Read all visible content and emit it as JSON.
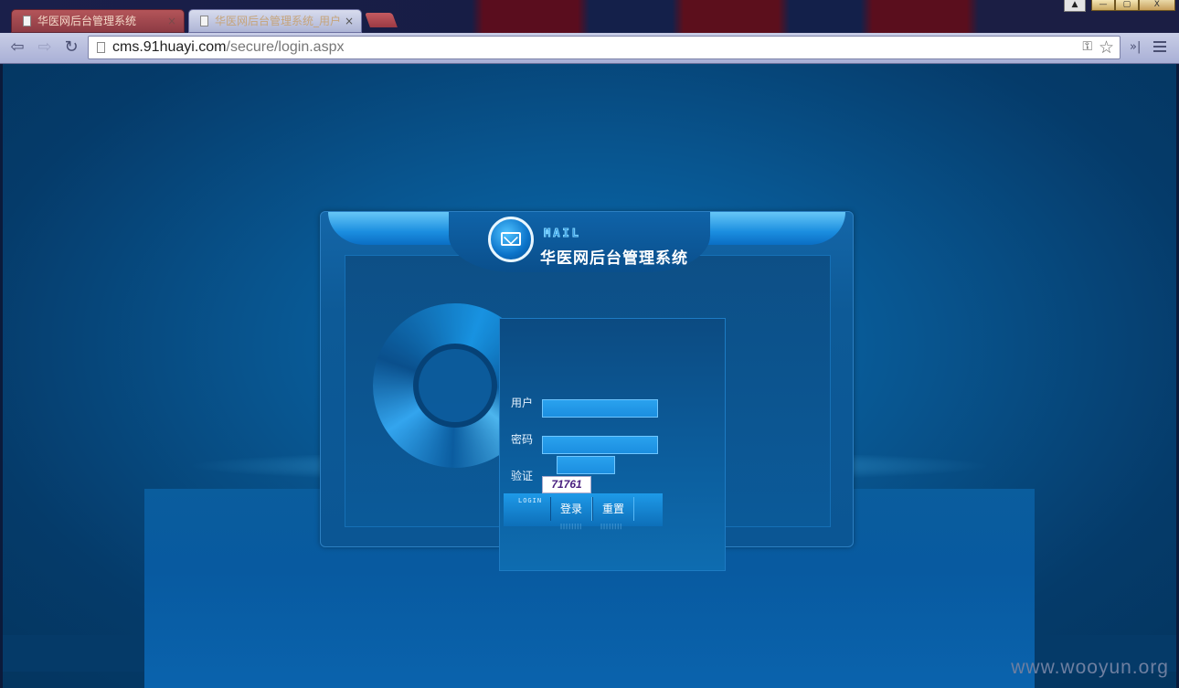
{
  "browser": {
    "tabs": [
      {
        "label": "华医网后台管理系统",
        "active": false
      },
      {
        "label": "华医网后台管理系统_用户",
        "active": true
      }
    ],
    "close_glyph": "×",
    "user_glyph": "▲",
    "window_buttons": {
      "minimize": "—",
      "maximize": "▢",
      "close": "X"
    },
    "nav": {
      "back": "⇦",
      "forward": "⇨",
      "reload": "↻"
    },
    "address": {
      "host": "cms.91huayi.com",
      "path": "/secure/login.aspx"
    },
    "key_glyph": "⚿",
    "star_glyph": "☆",
    "extensions_glyph": "»|",
    "accent_color": "#a9b0d6"
  },
  "page": {
    "mail_word": "MAIL",
    "system_title": "华医网后台管理系统",
    "form": {
      "username_label": "用户",
      "password_label": "密码",
      "captcha_label": "验证",
      "captcha_code": "71761",
      "login_tag": "LOGIN",
      "login_button": "登录",
      "reset_button": "重置",
      "username_value": "",
      "password_value": "",
      "captcha_value": ""
    },
    "watermark": "www.wooyun.org"
  }
}
